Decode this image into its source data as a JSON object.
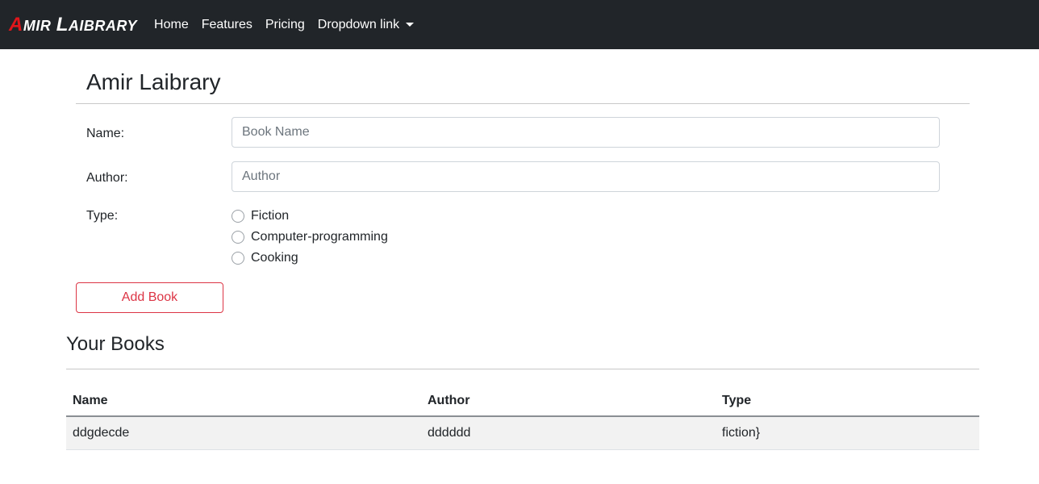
{
  "navbar": {
    "brand": {
      "first_cap": "A",
      "first_rest": "MIR",
      "second_cap": "L",
      "second_rest": "AIBRARY"
    },
    "links": [
      "Home",
      "Features",
      "Pricing"
    ],
    "dropdown_label": "Dropdown link"
  },
  "page": {
    "title": "Amir Laibrary"
  },
  "form": {
    "name_label": "Name:",
    "name_placeholder": "Book Name",
    "author_label": "Author:",
    "author_placeholder": "Author",
    "type_label": "Type:",
    "types": [
      "Fiction",
      "Computer-programming",
      "Cooking"
    ],
    "submit_label": "Add Book"
  },
  "books": {
    "title": "Your Books",
    "headers": [
      "Name",
      "Author",
      "Type"
    ],
    "rows": [
      [
        "ddgdecde",
        "dddddd",
        "fiction}"
      ]
    ]
  },
  "colors": {
    "navbar_bg": "#212529",
    "brand_accent": "#e0161b",
    "button_danger": "#dc3545"
  }
}
